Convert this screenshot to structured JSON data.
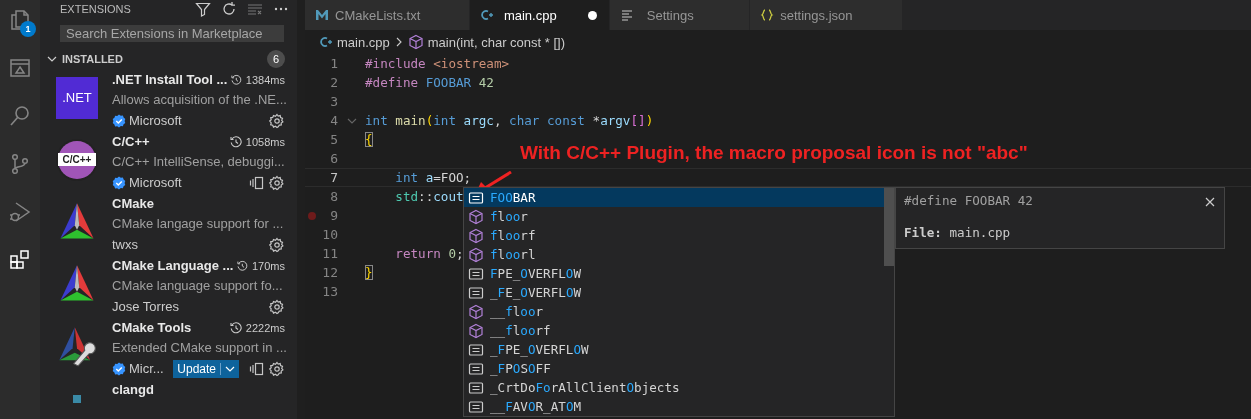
{
  "activity_bar": {
    "items": [
      {
        "kind": "files",
        "selected": false,
        "badge": "1"
      },
      {
        "kind": "remote",
        "selected": false
      },
      {
        "kind": "search",
        "selected": false
      },
      {
        "kind": "scm",
        "selected": false
      },
      {
        "kind": "debug",
        "selected": false
      },
      {
        "kind": "extensions",
        "selected": true
      }
    ]
  },
  "sidebar": {
    "title": "EXTENSIONS",
    "search": {
      "placeholder": "Search Extensions in Marketplace"
    },
    "section": {
      "title": "INSTALLED",
      "expanded": true,
      "count": "6"
    },
    "extensions": [
      {
        "kind": "dotnet",
        "logo_text": ".NET",
        "name": ".NET Install Tool ...",
        "load_time": "1384ms",
        "description": "Allows acquisition of the .NE...",
        "publisher": "Microsoft",
        "verified": true
      },
      {
        "kind": "cpp",
        "logo_text": "C/C++",
        "name": "C/C++",
        "load_time": "1058ms",
        "description": "C/C++ IntelliSense, debuggi...",
        "publisher": "Microsoft",
        "verified": true,
        "sync": true
      },
      {
        "kind": "cmake",
        "name": "CMake",
        "description": "CMake langage support for ...",
        "publisher": "twxs",
        "verified": false
      },
      {
        "kind": "cmake",
        "name": "CMake Language ...",
        "load_time": "170ms",
        "description": "CMake language support fo...",
        "publisher": "Jose Torres",
        "verified": false
      },
      {
        "kind": "cmaketools",
        "name": "CMake Tools",
        "load_time": "2222ms",
        "description": "Extended CMake support in ...",
        "publisher": "Micr...",
        "verified": true,
        "update": "Update",
        "sync": true
      },
      {
        "kind": "clangd",
        "name": "clangd"
      }
    ]
  },
  "tabs": [
    {
      "kind": "cmake",
      "label": "CMakeLists.txt",
      "selected": false,
      "modified": false
    },
    {
      "kind": "cpp",
      "label": "main.cpp",
      "selected": true,
      "modified": true
    },
    {
      "kind": "settings",
      "label": "Settings",
      "selected": false,
      "modified": false
    },
    {
      "kind": "json",
      "label": "settings.json",
      "selected": false,
      "modified": false
    }
  ],
  "breadcrumbs": [
    {
      "kind": "cpp",
      "label": "main.cpp"
    },
    {
      "kind": "function",
      "label": "main(int, char const * [])"
    }
  ],
  "code": {
    "lines": [
      {
        "number": "1",
        "tokens": [
          {
            "text": "#include",
            "kind": "pp"
          },
          {
            "text": " <iostream>",
            "kind": "str"
          }
        ]
      },
      {
        "number": "2",
        "tokens": [
          {
            "text": "#define",
            "kind": "pp"
          },
          {
            "text": " FOOBAR",
            "kind": "macro"
          },
          {
            "text": " 42",
            "kind": "num"
          }
        ]
      },
      {
        "number": "3"
      },
      {
        "number": "4",
        "fold": true,
        "tokens": [
          {
            "text": "int",
            "kind": "kw"
          },
          {
            "text": " main",
            "kind": "fn"
          },
          {
            "text": "(",
            "kind": "b1"
          },
          {
            "text": "int",
            "kind": "kw"
          },
          {
            "text": " argc",
            "kind": "var"
          },
          {
            "text": ", ",
            "kind": "punct"
          },
          {
            "text": "char",
            "kind": "kw"
          },
          {
            "text": " const",
            "kind": "kw"
          },
          {
            "text": " *",
            "kind": "punct"
          },
          {
            "text": "argv",
            "kind": "var"
          },
          {
            "text": "[]",
            "kind": "b2"
          },
          {
            "text": ")",
            "kind": "b1"
          }
        ]
      },
      {
        "number": "5",
        "tokens": [
          {
            "text": "{",
            "kind": "b1",
            "matched": true
          }
        ]
      },
      {
        "number": "6"
      },
      {
        "number": "7",
        "current": true,
        "tokens": [
          {
            "text": "    int",
            "kind": "kw"
          },
          {
            "text": " a",
            "kind": "var"
          },
          {
            "text": "=FOO;",
            "kind": "punct"
          }
        ]
      },
      {
        "number": "8",
        "tokens": [
          {
            "text": "    std",
            "kind": "type"
          },
          {
            "text": "::",
            "kind": "punct"
          },
          {
            "text": "cout",
            "kind": "var"
          }
        ]
      },
      {
        "number": "9",
        "breakpoint": true
      },
      {
        "number": "10"
      },
      {
        "number": "11",
        "tokens": [
          {
            "text": "    return",
            "kind": "ctrl"
          },
          {
            "text": " 0",
            "kind": "num"
          },
          {
            "text": ";",
            "kind": "punct"
          }
        ]
      },
      {
        "number": "12",
        "tokens": [
          {
            "text": "}",
            "kind": "b1",
            "matched": true
          }
        ]
      },
      {
        "number": "13"
      }
    ]
  },
  "annotation": {
    "text": "With C/C++ Plugin, the macro proposal icon is not \"abc\""
  },
  "suggestions": {
    "items": [
      {
        "kind": "constant",
        "selected": true,
        "label": "**FOO**BAR"
      },
      {
        "kind": "method",
        "selected": false,
        "label": "**f**l**oo**r"
      },
      {
        "kind": "method",
        "selected": false,
        "label": "**f**l**oo**rf"
      },
      {
        "kind": "method",
        "selected": false,
        "label": "**f**l**oo**rl"
      },
      {
        "kind": "constant",
        "selected": false,
        "label": "**F**PE_**O**VERFL**O**W"
      },
      {
        "kind": "constant",
        "selected": false,
        "label": "_**F**E_**O**VERFL**O**W"
      },
      {
        "kind": "method",
        "selected": false,
        "label": "__**f**l**oo**r"
      },
      {
        "kind": "method",
        "selected": false,
        "label": "__**f**l**oo**rf"
      },
      {
        "kind": "constant",
        "selected": false,
        "label": "_**F**PE_**O**VERFL**O**W"
      },
      {
        "kind": "constant",
        "selected": false,
        "label": "_**F**P**O**S**O**FF"
      },
      {
        "kind": "constant",
        "selected": false,
        "label": "_CrtDo**Fo**rAllClient**O**bjects"
      },
      {
        "kind": "constant",
        "selected": false,
        "label": "__**F**AV**O**R_AT**O**M"
      }
    ]
  },
  "details": {
    "signature": "#define FOOBAR 42",
    "file": "**File:** main.cpp"
  }
}
